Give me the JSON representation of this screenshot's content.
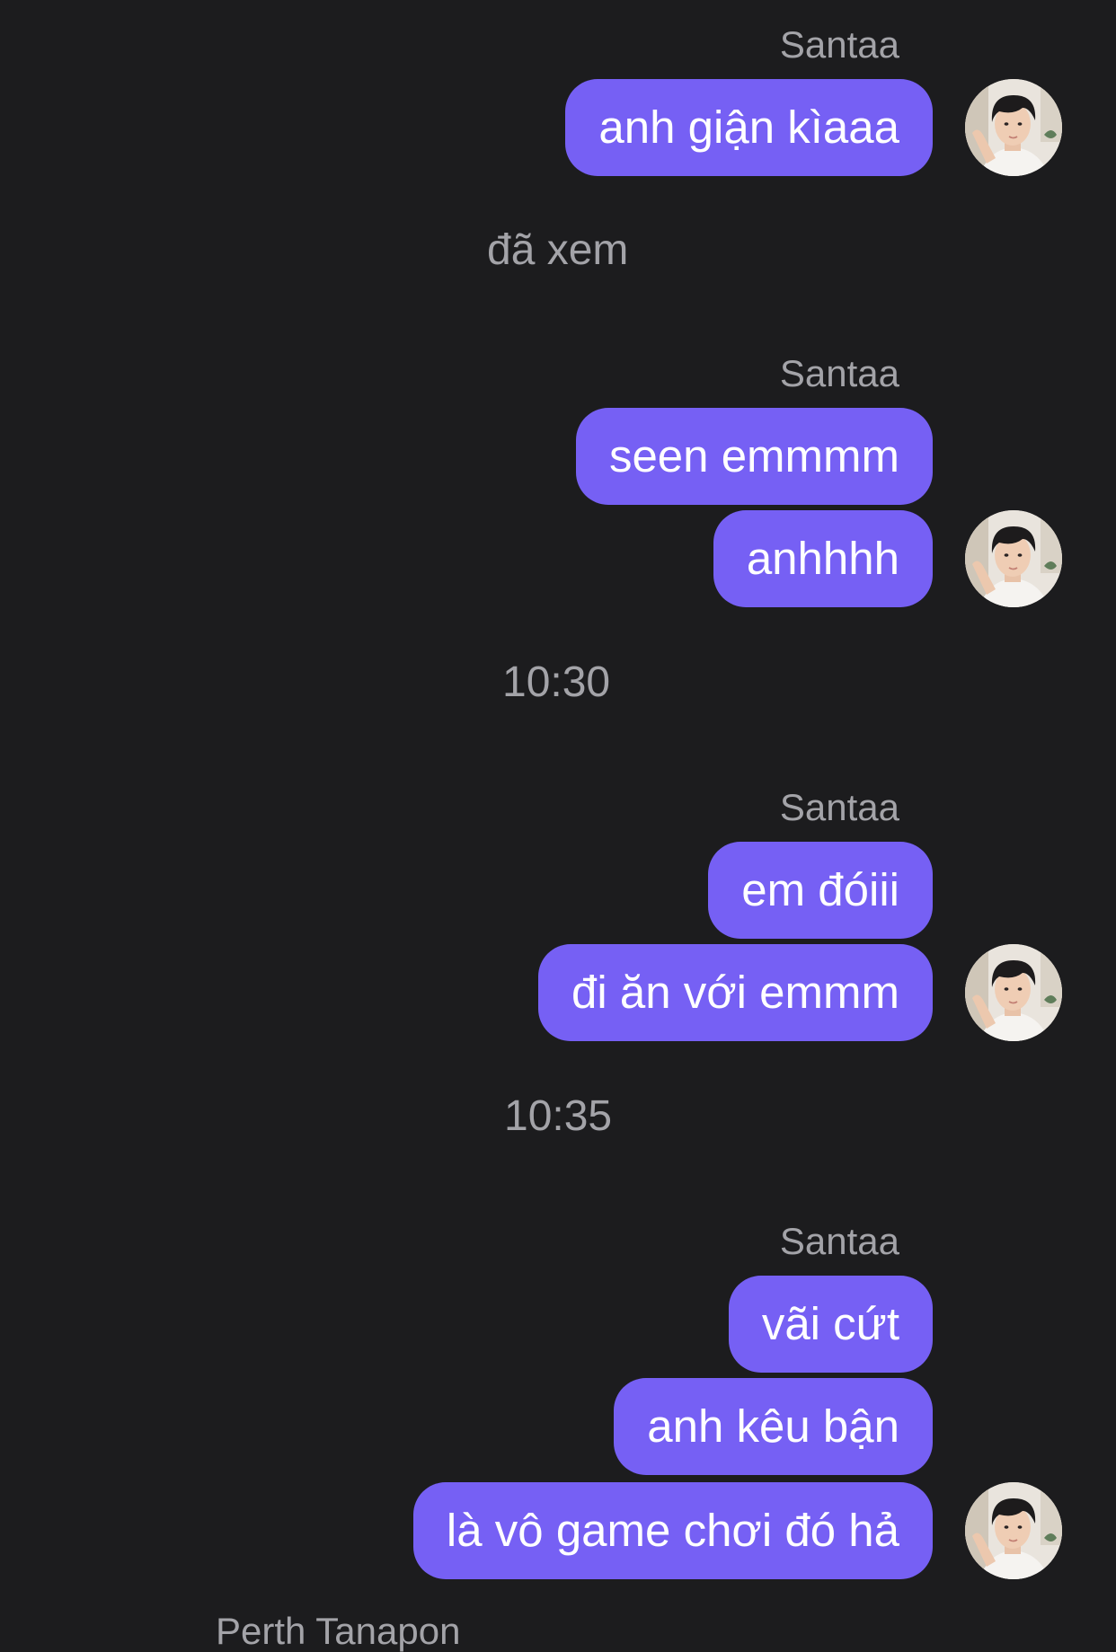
{
  "colors": {
    "background": "#1c1c1e",
    "bubble": "#7660f4",
    "meta_text": "#a3a3a8",
    "bubble_text": "#ffffff"
  },
  "groups": [
    {
      "sender": "Santaa",
      "avatar_icon": "profile-photo",
      "messages": [
        "anh giận kìaaa"
      ]
    },
    {
      "sender": "Santaa",
      "avatar_icon": "profile-photo",
      "messages": [
        "seen emmmm",
        "anhhhh"
      ]
    },
    {
      "sender": "Santaa",
      "avatar_icon": "profile-photo",
      "messages": [
        "em đóiii",
        "đi ăn với emmm"
      ]
    },
    {
      "sender": "Santaa",
      "avatar_icon": "profile-photo",
      "messages": [
        "vãi cứt",
        "anh kêu bận",
        "là vô game chơi đó hả"
      ]
    }
  ],
  "seen_label": "đã xem",
  "timestamps": [
    "10:30",
    "10:35"
  ],
  "next_sender_partial": "Perth Tanapon"
}
